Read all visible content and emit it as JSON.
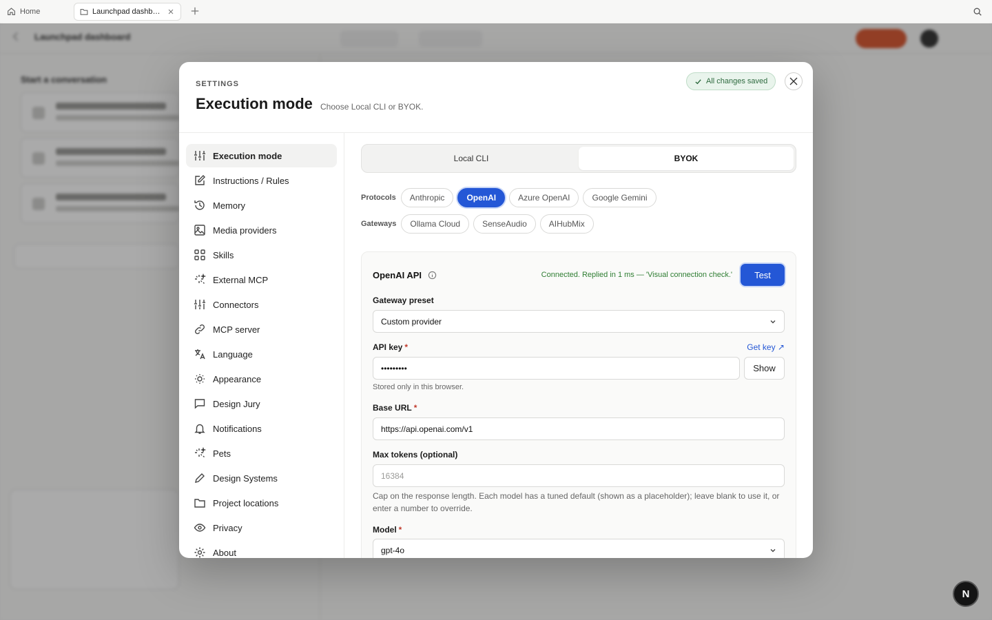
{
  "browser": {
    "home_tab": "Home",
    "active_tab": "Launchpad dashboard"
  },
  "background": {
    "title": "Launchpad dashboard",
    "heading": "Start a conversation"
  },
  "modal": {
    "kicker": "SETTINGS",
    "title": "Execution mode",
    "subtitle": "Choose Local CLI or BYOK.",
    "saved_status": "All changes saved"
  },
  "sidebar": {
    "items": [
      {
        "label": "Execution mode",
        "icon": "sliders-icon"
      },
      {
        "label": "Instructions / Rules",
        "icon": "edit-icon"
      },
      {
        "label": "Memory",
        "icon": "history-icon"
      },
      {
        "label": "Media providers",
        "icon": "image-icon"
      },
      {
        "label": "Skills",
        "icon": "grid-icon"
      },
      {
        "label": "External MCP",
        "icon": "sparkle-icon"
      },
      {
        "label": "Connectors",
        "icon": "sliders-icon"
      },
      {
        "label": "MCP server",
        "icon": "link-icon"
      },
      {
        "label": "Language",
        "icon": "translate-icon"
      },
      {
        "label": "Appearance",
        "icon": "sun-icon"
      },
      {
        "label": "Design Jury",
        "icon": "chat-icon"
      },
      {
        "label": "Notifications",
        "icon": "bell-icon"
      },
      {
        "label": "Pets",
        "icon": "sparkle-icon"
      },
      {
        "label": "Design Systems",
        "icon": "pen-icon"
      },
      {
        "label": "Project locations",
        "icon": "folder-icon"
      },
      {
        "label": "Privacy",
        "icon": "eye-icon"
      },
      {
        "label": "About",
        "icon": "gear-icon"
      }
    ]
  },
  "mode": {
    "options": [
      "Local CLI",
      "BYOK"
    ],
    "selected": "BYOK"
  },
  "protocols": {
    "label": "Protocols",
    "items": [
      "Anthropic",
      "OpenAI",
      "Azure OpenAI",
      "Google Gemini"
    ],
    "selected": "OpenAI"
  },
  "gateways": {
    "label": "Gateways",
    "items": [
      "Ollama Cloud",
      "SenseAudio",
      "AIHubMix"
    ]
  },
  "panel": {
    "title": "OpenAI API",
    "status": "Connected. Replied in 1 ms — 'Visual connection check.'",
    "test_label": "Test",
    "gateway_preset_label": "Gateway preset",
    "gateway_preset_value": "Custom provider",
    "api_key_label": "API key",
    "get_key_label": "Get key ↗",
    "api_key_value": "•••••••••",
    "show_label": "Show",
    "api_key_help": "Stored only in this browser.",
    "base_url_label": "Base URL",
    "base_url_value": "https://api.openai.com/v1",
    "max_tokens_label": "Max tokens (optional)",
    "max_tokens_placeholder": "16384",
    "max_tokens_help": "Cap on the response length. Each model has a tuned default (shown as a placeholder); leave blank to use it, or enter a number to override.",
    "model_label": "Model",
    "model_value": "gpt-4o",
    "required_mark": "*"
  },
  "floating_avatar": "N",
  "colors": {
    "accent": "#2457d6",
    "success": "#2e7d32",
    "saved_bg": "#e9f4ec"
  }
}
